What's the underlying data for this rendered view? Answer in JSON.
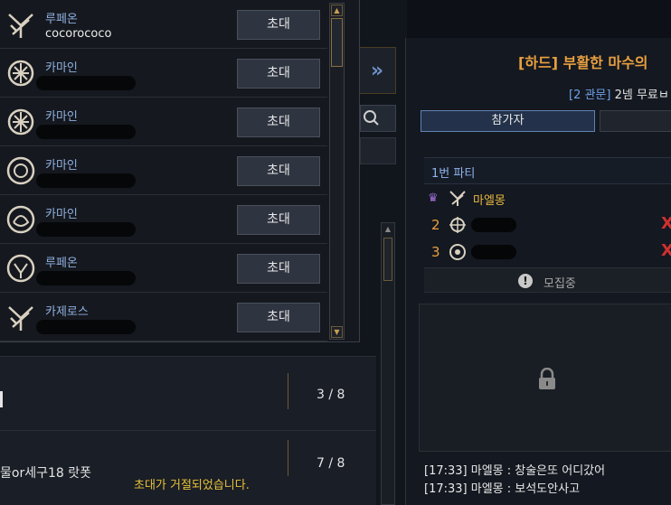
{
  "invite_list": {
    "invite_label": "초대",
    "rows": [
      {
        "class": "루페온",
        "nickname": "cocorococo",
        "emblem": "lupeon-emblem-icon"
      },
      {
        "class": "카마인",
        "nickname": "",
        "emblem": "kamine-emblem-icon"
      },
      {
        "class": "카마인",
        "nickname": "",
        "emblem": "kamine-emblem-icon"
      },
      {
        "class": "카마인",
        "nickname": "",
        "emblem": "kamine-emblem-icon"
      },
      {
        "class": "카마인",
        "nickname": "",
        "emblem": "kamine-emblem-icon"
      },
      {
        "class": "루페온",
        "nickname": "",
        "emblem": "lupeon-emblem-icon"
      },
      {
        "class": "카제로스",
        "nickname": "",
        "emblem": "kazeros-emblem-icon"
      }
    ]
  },
  "party_list": {
    "rows": [
      {
        "title": "",
        "count": "3 / 8"
      },
      {
        "title": "물or세구18 랏폿",
        "count": "7 / 8"
      }
    ],
    "status_message": "초대가 거절되었습니다."
  },
  "raid": {
    "title": "[하드] 부활한 마수의",
    "subtitle_tag": "[2 관문]",
    "subtitle_text": "2넴 무료ㅂ",
    "tab_participants": "참가자",
    "party_header": "1번 파티",
    "leader_name": "마엘몽",
    "members": [
      "2",
      "3"
    ],
    "recruiting_label": "모집중",
    "chat": [
      "[17:33] 마엘몽 : 창술은또 어디갔어",
      "[17:33] 마엘몽 : 보석도안사고"
    ]
  },
  "colors": {
    "accent_gold": "#e8a040",
    "accent_blue": "#6da0e8",
    "kick_red": "#d03030"
  }
}
